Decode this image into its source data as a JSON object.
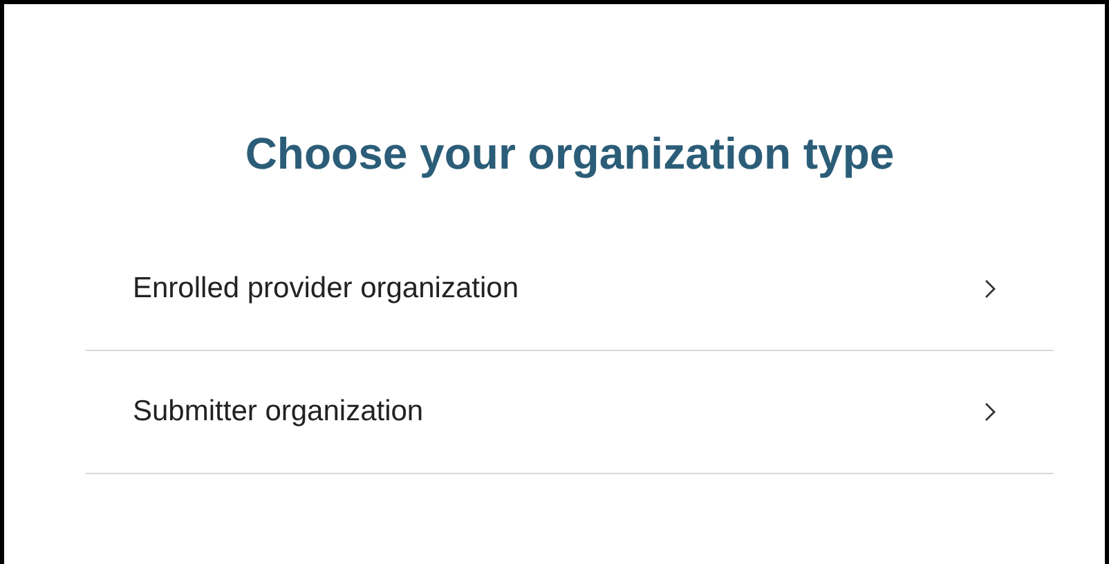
{
  "title": "Choose your organization type",
  "options": [
    {
      "label": "Enrolled provider organization"
    },
    {
      "label": "Submitter organization"
    }
  ]
}
